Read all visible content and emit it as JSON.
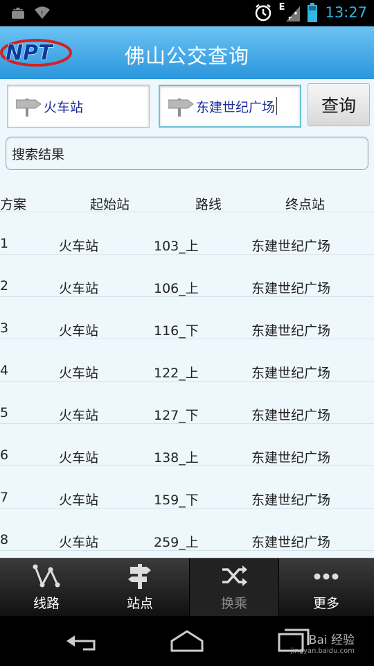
{
  "status_bar": {
    "time": "13:27",
    "network_label": "E"
  },
  "header": {
    "logo_text": "NPT",
    "title": "佛山公交查询"
  },
  "search": {
    "from_value": "火车站",
    "to_value": "东建世纪广场",
    "query_label": "查询",
    "result_label": "搜索结果"
  },
  "table": {
    "headers": [
      "方案",
      "起始站",
      "路线",
      "终点站"
    ],
    "rows": [
      [
        "1",
        "火车站",
        "103_上",
        "东建世纪广场"
      ],
      [
        "2",
        "火车站",
        "106_上",
        "东建世纪广场"
      ],
      [
        "3",
        "火车站",
        "116_下",
        "东建世纪广场"
      ],
      [
        "4",
        "火车站",
        "122_上",
        "东建世纪广场"
      ],
      [
        "5",
        "火车站",
        "127_下",
        "东建世纪广场"
      ],
      [
        "6",
        "火车站",
        "138_上",
        "东建世纪广场"
      ],
      [
        "7",
        "火车站",
        "159_下",
        "东建世纪广场"
      ],
      [
        "8",
        "火车站",
        "259_上",
        "东建世纪广场"
      ]
    ]
  },
  "tabbar": {
    "tabs": [
      {
        "label": "线路",
        "icon": "route-icon"
      },
      {
        "label": "站点",
        "icon": "signpost-icon"
      },
      {
        "label": "换乘",
        "icon": "shuffle-icon"
      },
      {
        "label": "更多",
        "icon": "more-icon"
      }
    ],
    "active_index": 2
  },
  "watermark": {
    "text": "Bai 经验",
    "sub": "jingyan.baidu.com"
  },
  "colors": {
    "header_top": "#6cc2f4",
    "header_bottom": "#2a96dc",
    "time": "#33b5e5",
    "input_text": "#1a2a9a"
  }
}
